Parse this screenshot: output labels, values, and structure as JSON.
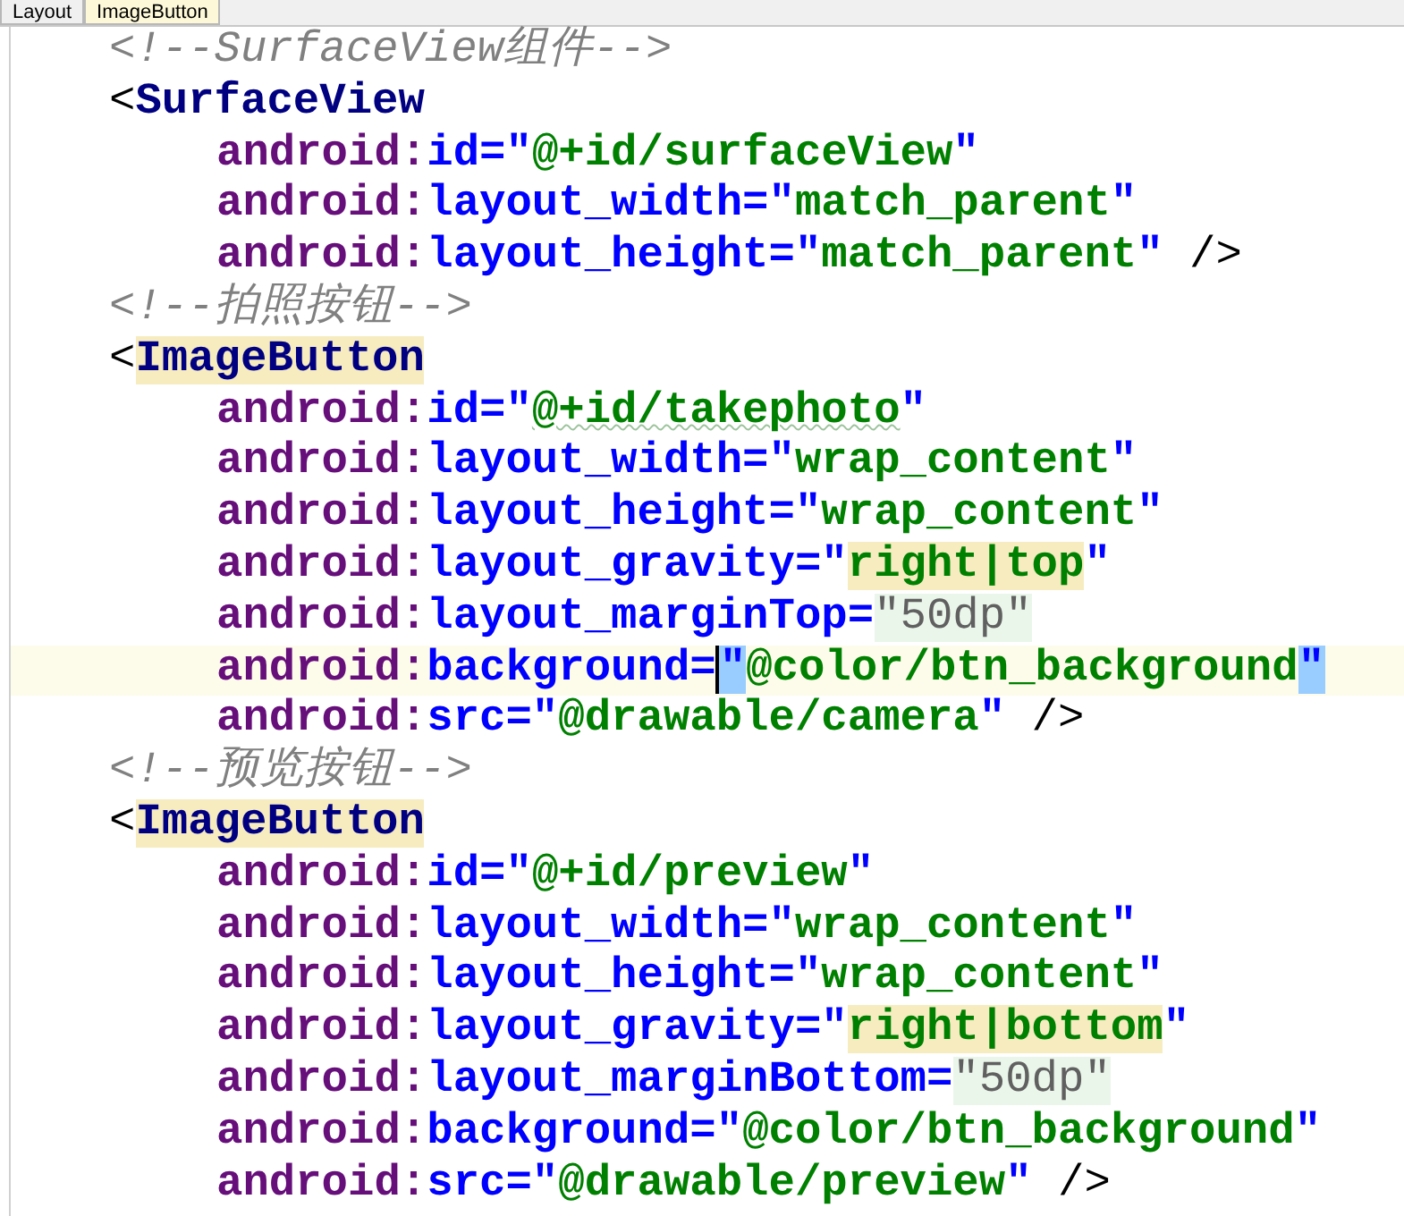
{
  "breadcrumbs": [
    {
      "label": "Layout",
      "selected": false
    },
    {
      "label": "ImageButton",
      "selected": true
    }
  ],
  "lines": [
    {
      "kind": "comment",
      "current": false,
      "tokens": [
        {
          "kind": "comment",
          "text": "<!--SurfaceView组件-->"
        }
      ]
    },
    {
      "kind": "tag",
      "current": false,
      "tokens": [
        {
          "kind": "punct",
          "text": "<"
        },
        {
          "kind": "tag",
          "text": "SurfaceView"
        }
      ]
    },
    {
      "kind": "attribute",
      "current": false,
      "tokens": [
        {
          "kind": "ns",
          "text": "android:"
        },
        {
          "kind": "attr",
          "text": "id=\""
        },
        {
          "kind": "string",
          "text": "@+id/surfaceView"
        },
        {
          "kind": "attr",
          "text": "\""
        }
      ]
    },
    {
      "kind": "attribute",
      "current": false,
      "tokens": [
        {
          "kind": "ns",
          "text": "android:"
        },
        {
          "kind": "attr",
          "text": "layout_width=\""
        },
        {
          "kind": "string",
          "text": "match_parent"
        },
        {
          "kind": "attr",
          "text": "\""
        }
      ]
    },
    {
      "kind": "attribute",
      "current": false,
      "tokens": [
        {
          "kind": "ns",
          "text": "android:"
        },
        {
          "kind": "attr",
          "text": "layout_height=\""
        },
        {
          "kind": "string",
          "text": "match_parent"
        },
        {
          "kind": "attr",
          "text": "\""
        },
        {
          "kind": "punct",
          "text": " />"
        }
      ]
    },
    {
      "kind": "comment",
      "current": false,
      "tokens": [
        {
          "kind": "comment",
          "text": "<!--拍照按钮-->"
        }
      ]
    },
    {
      "kind": "tag",
      "current": false,
      "tokens": [
        {
          "kind": "punct",
          "text": "<"
        },
        {
          "kind": "tag",
          "text": "ImageButton",
          "usage_highlight": true
        }
      ]
    },
    {
      "kind": "attribute",
      "current": false,
      "tokens": [
        {
          "kind": "ns",
          "text": "android:"
        },
        {
          "kind": "attr",
          "text": "id=\""
        },
        {
          "kind": "string",
          "text": "@+id/takephoto",
          "typo": true
        },
        {
          "kind": "attr",
          "text": "\""
        }
      ]
    },
    {
      "kind": "attribute",
      "current": false,
      "tokens": [
        {
          "kind": "ns",
          "text": "android:"
        },
        {
          "kind": "attr",
          "text": "layout_width=\""
        },
        {
          "kind": "string",
          "text": "wrap_content"
        },
        {
          "kind": "attr",
          "text": "\""
        }
      ]
    },
    {
      "kind": "attribute",
      "current": false,
      "tokens": [
        {
          "kind": "ns",
          "text": "android:"
        },
        {
          "kind": "attr",
          "text": "layout_height=\""
        },
        {
          "kind": "string",
          "text": "wrap_content"
        },
        {
          "kind": "attr",
          "text": "\""
        }
      ]
    },
    {
      "kind": "attribute",
      "current": false,
      "tokens": [
        {
          "kind": "ns",
          "text": "android:"
        },
        {
          "kind": "attr",
          "text": "layout_gravity=\""
        },
        {
          "kind": "string",
          "text": "right|top",
          "usage_highlight": true
        },
        {
          "kind": "attr",
          "text": "\""
        }
      ]
    },
    {
      "kind": "attribute",
      "current": false,
      "tokens": [
        {
          "kind": "ns",
          "text": "android:"
        },
        {
          "kind": "attr",
          "text": "layout_marginTop="
        },
        {
          "kind": "dimen",
          "text": "\"50dp\"",
          "edited": true
        }
      ]
    },
    {
      "kind": "attribute",
      "current": true,
      "tokens": [
        {
          "kind": "ns",
          "text": "android:"
        },
        {
          "kind": "attr",
          "text": "background="
        },
        {
          "kind": "attr",
          "text": "\"",
          "brace_matched": true,
          "caret": true
        },
        {
          "kind": "string",
          "text": "@color/btn_background"
        },
        {
          "kind": "attr",
          "text": "\"",
          "brace_matched": true
        }
      ]
    },
    {
      "kind": "attribute",
      "current": false,
      "tokens": [
        {
          "kind": "ns",
          "text": "android:"
        },
        {
          "kind": "attr",
          "text": "src=\""
        },
        {
          "kind": "string",
          "text": "@drawable/camera"
        },
        {
          "kind": "attr",
          "text": "\""
        },
        {
          "kind": "punct",
          "text": " />"
        }
      ]
    },
    {
      "kind": "comment",
      "current": false,
      "tokens": [
        {
          "kind": "comment",
          "text": "<!--预览按钮-->"
        }
      ]
    },
    {
      "kind": "tag",
      "current": false,
      "tokens": [
        {
          "kind": "punct",
          "text": "<"
        },
        {
          "kind": "tag",
          "text": "ImageButton",
          "usage_highlight": true
        }
      ]
    },
    {
      "kind": "attribute",
      "current": false,
      "tokens": [
        {
          "kind": "ns",
          "text": "android:"
        },
        {
          "kind": "attr",
          "text": "id=\""
        },
        {
          "kind": "string",
          "text": "@+id/preview"
        },
        {
          "kind": "attr",
          "text": "\""
        }
      ]
    },
    {
      "kind": "attribute",
      "current": false,
      "tokens": [
        {
          "kind": "ns",
          "text": "android:"
        },
        {
          "kind": "attr",
          "text": "layout_width=\""
        },
        {
          "kind": "string",
          "text": "wrap_content"
        },
        {
          "kind": "attr",
          "text": "\""
        }
      ]
    },
    {
      "kind": "attribute",
      "current": false,
      "tokens": [
        {
          "kind": "ns",
          "text": "android:"
        },
        {
          "kind": "attr",
          "text": "layout_height=\""
        },
        {
          "kind": "string",
          "text": "wrap_content"
        },
        {
          "kind": "attr",
          "text": "\""
        }
      ]
    },
    {
      "kind": "attribute",
      "current": false,
      "tokens": [
        {
          "kind": "ns",
          "text": "android:"
        },
        {
          "kind": "attr",
          "text": "layout_gravity=\""
        },
        {
          "kind": "string",
          "text": "right|bottom",
          "usage_highlight": true
        },
        {
          "kind": "attr",
          "text": "\""
        }
      ]
    },
    {
      "kind": "attribute",
      "current": false,
      "tokens": [
        {
          "kind": "ns",
          "text": "android:"
        },
        {
          "kind": "attr",
          "text": "layout_marginBottom="
        },
        {
          "kind": "dimen",
          "text": "\"50dp\"",
          "edited": true
        }
      ]
    },
    {
      "kind": "attribute",
      "current": false,
      "tokens": [
        {
          "kind": "ns",
          "text": "android:"
        },
        {
          "kind": "attr",
          "text": "background=\""
        },
        {
          "kind": "string",
          "text": "@color/btn_background"
        },
        {
          "kind": "attr",
          "text": "\""
        }
      ]
    },
    {
      "kind": "attribute",
      "current": false,
      "tokens": [
        {
          "kind": "ns",
          "text": "android:"
        },
        {
          "kind": "attr",
          "text": "src=\""
        },
        {
          "kind": "string",
          "text": "@drawable/preview"
        },
        {
          "kind": "attr",
          "text": "\""
        },
        {
          "kind": "punct",
          "text": " />"
        }
      ]
    }
  ]
}
